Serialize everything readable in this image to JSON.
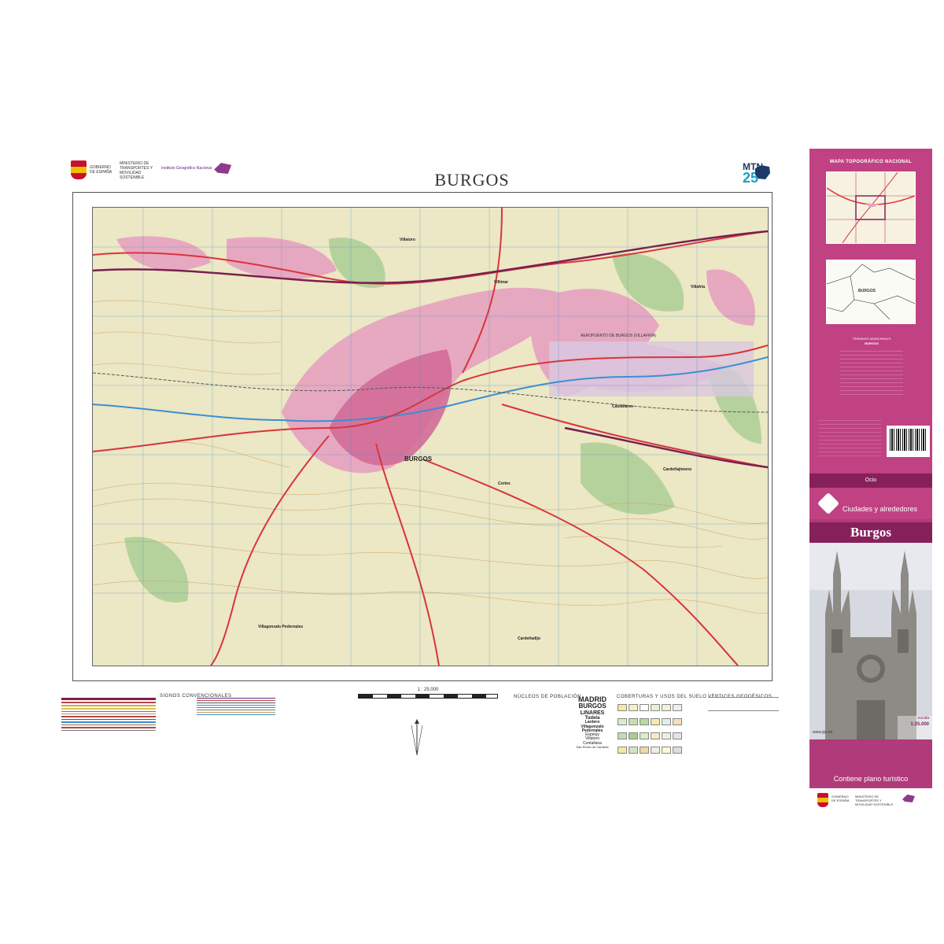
{
  "header": {
    "gov_line1": "GOBIERNO",
    "gov_line2": "DE ESPAÑA",
    "ministry": "MINISTERIO DE TRANSPORTES Y MOVILIDAD SOSTENIBLE",
    "ign_text": "Instituto Geográfico Nacional",
    "title": "BURGOS",
    "series": "MTN",
    "series_scale": "25"
  },
  "map": {
    "city_label": "BURGOS",
    "places": [
      "Villatoro",
      "Villimar",
      "Villafría",
      "Cardeñajimeno",
      "Castañares",
      "Villagonzalo Pedernales",
      "Cardeñadijo",
      "Cortes",
      "AEROPUERTO DE BURGOS (VILLAFRÍA)"
    ],
    "colors": {
      "terrain": "#ece7c4",
      "urban": "#e7a7c2",
      "road": "#d8343c",
      "water": "#3a8fd1",
      "forest": "#9ec48a"
    }
  },
  "legend": {
    "signos": "SIGNOS CONVENCIONALES",
    "scale": "1 : 25.000",
    "nucleos": "NÚCLEOS DE POBLACIÓN",
    "coberturas": "COBERTURAS Y USOS DEL SUELO",
    "vertices": "VÉRTICES GEODÉSICOS",
    "nucleos_samples": [
      "MADRID",
      "BURGOS",
      "LINARES",
      "Tudela",
      "Lardero",
      "Villagonzalo Pedernales",
      "Espeluy",
      "Villatoro",
      "Contallana",
      "San Pedro de Cardeña"
    ]
  },
  "sidebar": {
    "heading": "MAPA TOPOGRÁFICO NACIONAL",
    "inset_place": "BURGOS",
    "municipios_title": "TÉRMINOS MUNICIPALES",
    "municipios_sub": "BURGOS",
    "section": "Ocio",
    "collection": "Ciudades y alrededores",
    "cover_title": "Burgos",
    "escala_label": "escala",
    "escala_value": "1:25.000",
    "plano": "Contiene plano turístico",
    "web": "www.ign.es"
  }
}
